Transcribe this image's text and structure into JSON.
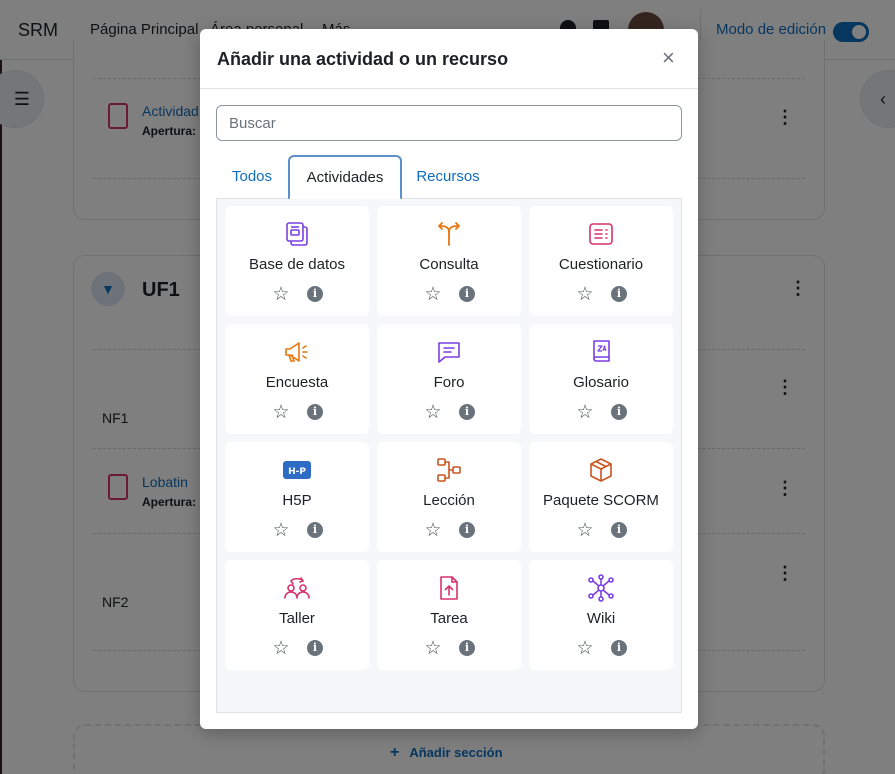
{
  "navbar": {
    "brand": "SRM",
    "links": [
      "Página Principal",
      "Área personal",
      "Más"
    ],
    "edit_mode_label": "Modo de edición"
  },
  "course": {
    "activity_link": "Actividad",
    "apertura_label": "Apertura:",
    "section_title": "UF1",
    "nf1": "NF1",
    "lobatin_link": "Lobatin",
    "apertura_label_2": "Apertura:",
    "nf2": "NF2",
    "add_section": "Añadir sección"
  },
  "modal": {
    "title": "Añadir una actividad o un recurso",
    "close_symbol": "×",
    "search_placeholder": "Buscar",
    "tabs": [
      "Todos",
      "Actividades",
      "Recursos"
    ],
    "active_tab": "Actividades",
    "items": [
      {
        "label": "Base de datos",
        "icon": "database-icon",
        "color": "#7b3fe4"
      },
      {
        "label": "Consulta",
        "icon": "choice-icon",
        "color": "#e8770e"
      },
      {
        "label": "Cuestionario",
        "icon": "quiz-icon",
        "color": "#d6336c"
      },
      {
        "label": "Encuesta",
        "icon": "megaphone-icon",
        "color": "#e8770e"
      },
      {
        "label": "Foro",
        "icon": "forum-icon",
        "color": "#7b3fe4"
      },
      {
        "label": "Glosario",
        "icon": "glossary-icon",
        "color": "#7b3fe4"
      },
      {
        "label": "H5P",
        "icon": "h5p-icon",
        "color": "#2e6bc4"
      },
      {
        "label": "Lección",
        "icon": "lesson-icon",
        "color": "#c8551f"
      },
      {
        "label": "Paquete SCORM",
        "icon": "package-icon",
        "color": "#c8551f"
      },
      {
        "label": "Taller",
        "icon": "workshop-icon",
        "color": "#d6336c"
      },
      {
        "label": "Tarea",
        "icon": "assignment-icon",
        "color": "#d6336c"
      },
      {
        "label": "Wiki",
        "icon": "wiki-icon",
        "color": "#7b3fe4"
      }
    ]
  }
}
